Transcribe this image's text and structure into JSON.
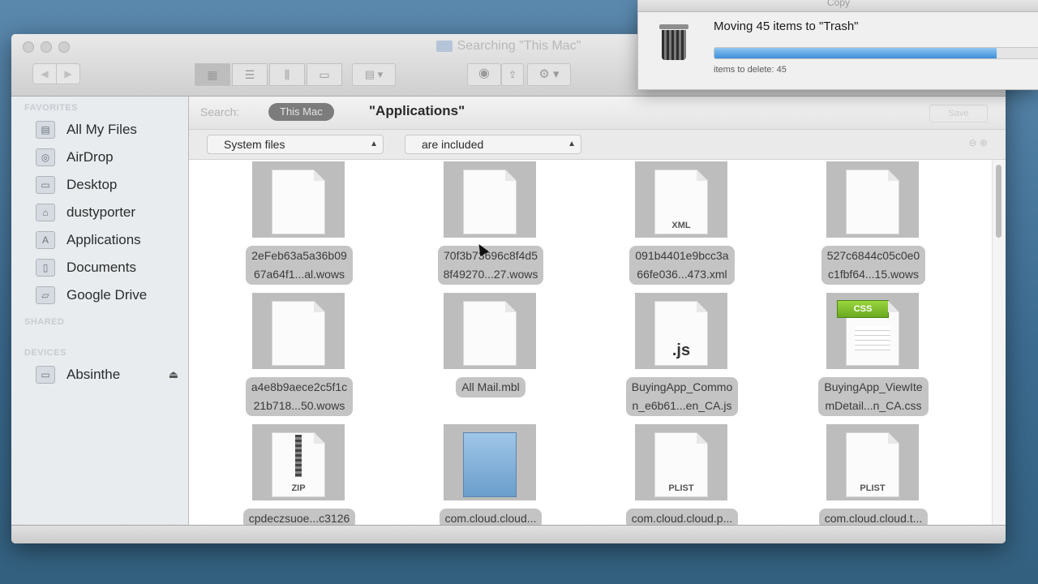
{
  "finder": {
    "title": "Searching \"This Mac\"",
    "sidebar": {
      "favorites_heading": "FAVORITES",
      "shared_heading": "SHARED",
      "devices_heading": "DEVICES",
      "favorites": [
        {
          "label": "All My Files",
          "icon": "all-files-icon"
        },
        {
          "label": "AirDrop",
          "icon": "airdrop-icon"
        },
        {
          "label": "Desktop",
          "icon": "desktop-icon"
        },
        {
          "label": "dustyporter",
          "icon": "home-icon"
        },
        {
          "label": "Applications",
          "icon": "applications-icon"
        },
        {
          "label": "Documents",
          "icon": "documents-icon"
        },
        {
          "label": "Google Drive",
          "icon": "folder-icon"
        }
      ],
      "devices": [
        {
          "label": "Absinthe",
          "icon": "disk-icon",
          "eject": "⏏"
        }
      ]
    },
    "search": {
      "search_label": "Search:",
      "scope_this_mac": "This Mac",
      "scope_apps": "\"Applications\"",
      "save_label": "Save"
    },
    "filter": {
      "attribute": "System files",
      "condition": "are included",
      "plus_minus": "⊖ ⊕"
    },
    "files": [
      {
        "line1": "2eFeb63a5a36b09",
        "line2": "67a64f1...al.wows",
        "type": "blank"
      },
      {
        "line1": "70f3b73696c8f4d5",
        "line2": "8f49270...27.wows",
        "type": "blank"
      },
      {
        "line1": "091b4401e9bcc3a",
        "line2": "66fe036...473.xml",
        "type": "xml",
        "tag": "XML"
      },
      {
        "line1": "527c6844c05c0e0",
        "line2": "c1fbf64...15.wows",
        "type": "blank"
      },
      {
        "line1": "a4e8b9aece2c5f1c",
        "line2": "21b718...50.wows",
        "type": "blank"
      },
      {
        "line1": "All Mail.mbl",
        "line2": "",
        "type": "blank"
      },
      {
        "line1": "BuyingApp_Commo",
        "line2": "n_e6b61...en_CA.js",
        "type": "js",
        "tag": ".js"
      },
      {
        "line1": "BuyingApp_ViewIte",
        "line2": "mDetail...n_CA.css",
        "type": "css",
        "tag": "CSS"
      },
      {
        "line1": "cpdeczsuoe...c3126",
        "line2": "",
        "type": "zip",
        "tag": "ZIP"
      },
      {
        "line1": "com.cloud.cloud...",
        "line2": "",
        "type": "folder",
        "tag": ""
      },
      {
        "line1": "com.cloud.cloud.p...",
        "line2": "",
        "type": "plist",
        "tag": "PLIST"
      },
      {
        "line1": "com.cloud.cloud.t...",
        "line2": "",
        "type": "plist",
        "tag": "PLIST"
      }
    ]
  },
  "progress": {
    "window_title": "Copy",
    "message": "Moving 45 items to \"Trash\"",
    "sub": "items to delete: 45",
    "percent": 0.87
  },
  "colors": {
    "desktop": "#3d6f96",
    "progress_fill": "#3f8ed8",
    "scope_pill": "#7c7c7c"
  }
}
